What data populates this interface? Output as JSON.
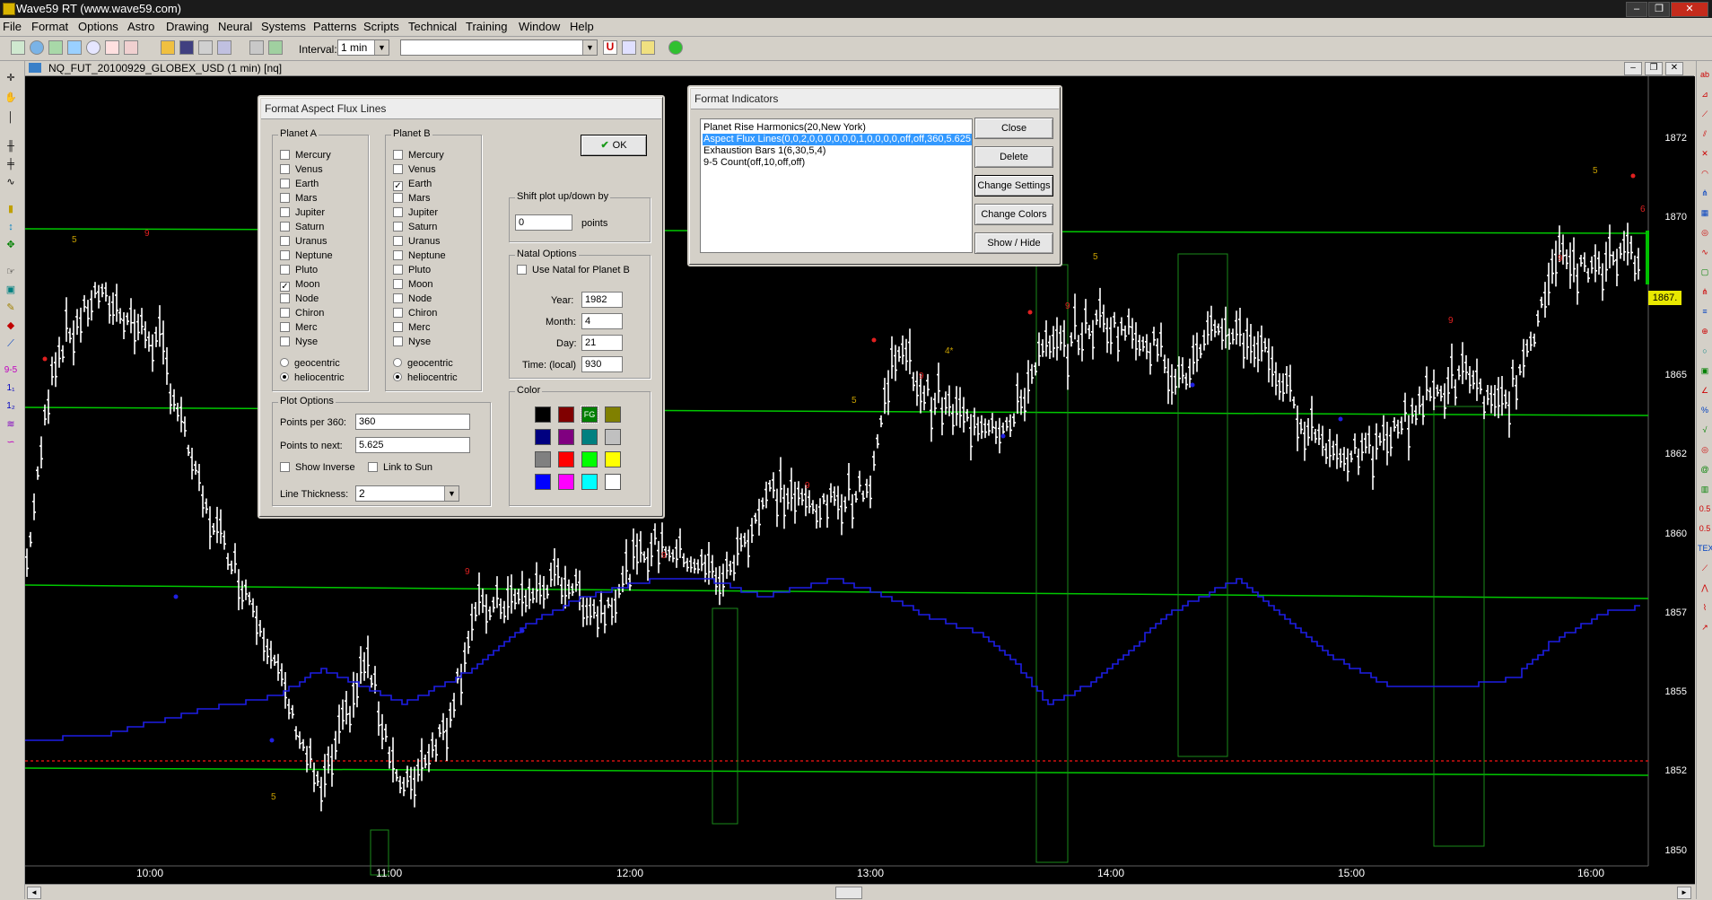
{
  "app": {
    "title": "Wave59 RT (www.wave59.com)"
  },
  "menu": [
    "File",
    "Format",
    "Options",
    "Astro",
    "Drawing",
    "Neural",
    "Systems",
    "Patterns",
    "Scripts",
    "Technical",
    "Training",
    "Window",
    "Help"
  ],
  "toolbar": {
    "interval_label": "Interval:",
    "interval_value": "1 min",
    "symbol_value": ""
  },
  "chart": {
    "caption": "NQ_FUT_20100929_GLOBEX_USD (1 min) [nq]",
    "price_labels": [
      "1872",
      "1870",
      "1867.",
      "1865",
      "1862",
      "1860",
      "1857",
      "1855",
      "1852",
      "1850"
    ],
    "current_price": "1867.",
    "time_labels": [
      "10:00",
      "11:00",
      "12:00",
      "13:00",
      "14:00",
      "15:00",
      "16:00"
    ],
    "colors": {
      "background": "#000000",
      "bars": "#ffffff",
      "flux_lines": "#00c800",
      "indicator_line": "#1e1ee6",
      "reference_line": "#d01010",
      "current_price_box": "#e8e800"
    },
    "bar_annotations": [
      "5",
      "9",
      "9",
      "5",
      "9",
      "9",
      "4*",
      "9",
      "5",
      "9",
      "5",
      "9",
      "9",
      "5",
      "6"
    ]
  },
  "dlg_aspect": {
    "title": "Format Aspect Flux Lines",
    "planet_a_label": "Planet A",
    "planet_b_label": "Planet B",
    "planets": [
      "Mercury",
      "Venus",
      "Earth",
      "Mars",
      "Jupiter",
      "Saturn",
      "Uranus",
      "Neptune",
      "Pluto",
      "Moon",
      "Node",
      "Chiron",
      "Merc",
      "Nyse"
    ],
    "planet_a_checked": "Moon",
    "planet_b_checked": "Earth",
    "geocentric": "geocentric",
    "heliocentric": "heliocentric",
    "planet_a_mode": "heliocentric",
    "planet_b_mode": "heliocentric",
    "ok": "OK",
    "shift_label": "Shift plot up/down by",
    "shift_value": "0",
    "shift_units": "points",
    "natal_label": "Natal Options",
    "use_natal": "Use Natal for Planet B",
    "year_label": "Year:",
    "year": "1982",
    "month_label": "Month:",
    "month": "4",
    "day_label": "Day:",
    "day": "21",
    "time_label": "Time: (local)",
    "time": "930",
    "plot_label": "Plot Options",
    "ppr_label": "Points per 360:",
    "ppr": "360",
    "ptn_label": "Points to next:",
    "ptn": "5.625",
    "show_inverse": "Show Inverse",
    "link_sun": "Link to Sun",
    "thickness_label": "Line Thickness:",
    "thickness": "2",
    "color_label": "Color",
    "color_swatches": [
      "#000000",
      "#800000",
      "#008000",
      "#808000",
      "#000080",
      "#800080",
      "#008080",
      "#c0c0c0",
      "#808080",
      "#ff0000",
      "#00ff00",
      "#ffff00",
      "#0000ff",
      "#ff00ff",
      "#00ffff",
      "#ffffff"
    ],
    "selected_swatch_text": "FG"
  },
  "dlg_indicators": {
    "title": "Format Indicators",
    "items": [
      "Planet Rise Harmonics(20,New York)",
      "Aspect Flux Lines(0,0,2,0,0,0,0,0,0,1,0,0,0,0,off,off,360,5.625",
      "Exhaustion Bars 1(6,30,5,4)",
      "9-5 Count(off,10,off,off)"
    ],
    "selected_index": 1,
    "buttons": [
      "Close",
      "Delete",
      "Change Settings",
      "Change Colors",
      "Show / Hide"
    ]
  }
}
